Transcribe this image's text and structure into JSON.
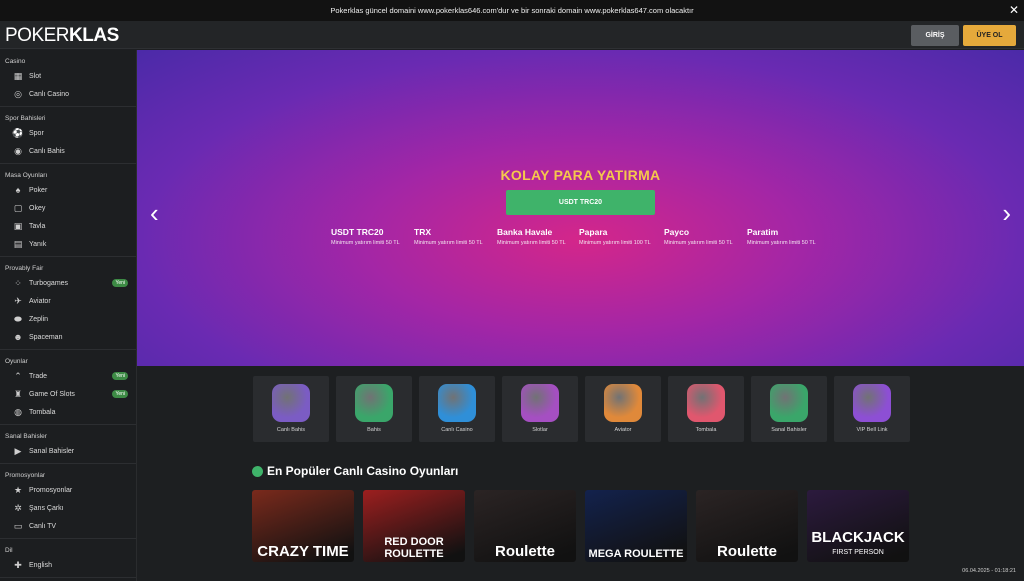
{
  "announcement": {
    "text": "Pokerklas güncel domaini www.pokerklas646.com'dur ve bir sonraki domain www.pokerklas647.com olacaktır",
    "close": "✕"
  },
  "header": {
    "logo_light": "POKER",
    "logo_bold": "KLAS",
    "login_label": "GİRİŞ",
    "register_label": "ÜYE OL"
  },
  "sidebar": {
    "sections": [
      {
        "title": "Casino",
        "items": [
          {
            "label": "Slot",
            "icon": "slot-icon"
          },
          {
            "label": "Canlı Casino",
            "icon": "chip-icon"
          }
        ]
      },
      {
        "title": "Spor Bahisleri",
        "items": [
          {
            "label": "Spor",
            "icon": "football-icon"
          },
          {
            "label": "Canlı Bahis",
            "icon": "live-broadcast-icon"
          }
        ]
      },
      {
        "title": "Masa Oyunları",
        "items": [
          {
            "label": "Poker",
            "icon": "cards-icon"
          },
          {
            "label": "Okey",
            "icon": "okey-icon"
          },
          {
            "label": "Tavla",
            "icon": "backgammon-icon"
          },
          {
            "label": "Yanık",
            "icon": "yanik-icon"
          }
        ]
      },
      {
        "title": "Provably Fair",
        "items": [
          {
            "label": "Turbogames",
            "icon": "turbogames-icon",
            "badge": "Yeni"
          },
          {
            "label": "Aviator",
            "icon": "plane-icon"
          },
          {
            "label": "Zeplin",
            "icon": "zeppelin-icon"
          },
          {
            "label": "Spaceman",
            "icon": "astronaut-icon"
          }
        ]
      },
      {
        "title": "Oyunlar",
        "items": [
          {
            "label": "Trade",
            "icon": "chart-line-icon",
            "badge": "Yeni"
          },
          {
            "label": "Game Of Slots",
            "icon": "castle-icon",
            "badge": "Yeni"
          },
          {
            "label": "Tombala",
            "icon": "bingo-ball-icon"
          }
        ]
      },
      {
        "title": "Sanal Bahisler",
        "items": [
          {
            "label": "Sanal Bahisler",
            "icon": "play-icon"
          }
        ]
      },
      {
        "title": "Promosyonlar",
        "items": [
          {
            "label": "Promosyonlar",
            "icon": "star-icon"
          },
          {
            "label": "Şans Çarkı",
            "icon": "wheel-icon"
          },
          {
            "label": "Canlı TV",
            "icon": "tv-icon"
          }
        ]
      },
      {
        "title": "Dil",
        "items": [
          {
            "label": "English",
            "icon": "uk-flag-icon"
          }
        ]
      }
    ]
  },
  "hero": {
    "title": "KOLAY PARA YATIRMA",
    "button": "USDT TRC20",
    "methods": [
      {
        "name": "USDT TRC20",
        "sub": "Minimum yatırım limiti 50 TL"
      },
      {
        "name": "TRX",
        "sub": "Minimum yatırım limiti 50 TL"
      },
      {
        "name": "Banka Havale",
        "sub": "Minimum yatırım limiti 50 TL"
      },
      {
        "name": "Papara",
        "sub": "Minimum yatırım limiti 100 TL"
      },
      {
        "name": "Payco",
        "sub": "Minimum yatırım limiti 50 TL"
      },
      {
        "name": "Paratim",
        "sub": "Minimum yatırım limiti 50 TL"
      }
    ],
    "prev": "‹",
    "next": "›"
  },
  "tiles": [
    {
      "label": "Canlı Bahis",
      "color": "#7b5cc4"
    },
    {
      "label": "Bahis",
      "color": "#3aa66a"
    },
    {
      "label": "Canlı Casino",
      "color": "#2f8fd8"
    },
    {
      "label": "Slotlar",
      "color": "#a54fc2"
    },
    {
      "label": "Aviator",
      "color": "#e0893a"
    },
    {
      "label": "Tombala",
      "color": "#e0576e"
    },
    {
      "label": "Sanal Bahisler",
      "color": "#3aa66a"
    },
    {
      "label": "VIP Bell Link",
      "color": "#8d4fd4"
    }
  ],
  "popular": {
    "title": "En Popüler Canlı Casino Oyunları",
    "games": [
      {
        "title": "CRAZY TIME",
        "color": "#7a2a1c"
      },
      {
        "title": "RED DOOR ROULETTE",
        "color": "#9c1f1f"
      },
      {
        "title": "Roulette",
        "color": "#2b2424"
      },
      {
        "title": "MEGA ROULETTE",
        "color": "#13224d"
      },
      {
        "title": "Roulette",
        "color": "#2b2424"
      },
      {
        "title": "BLACKJACK",
        "subtitle": "FIRST PERSON",
        "color": "#2c1a3e"
      }
    ]
  },
  "footer": {
    "timestamp": "06.04.2025 - 01:18:21"
  }
}
